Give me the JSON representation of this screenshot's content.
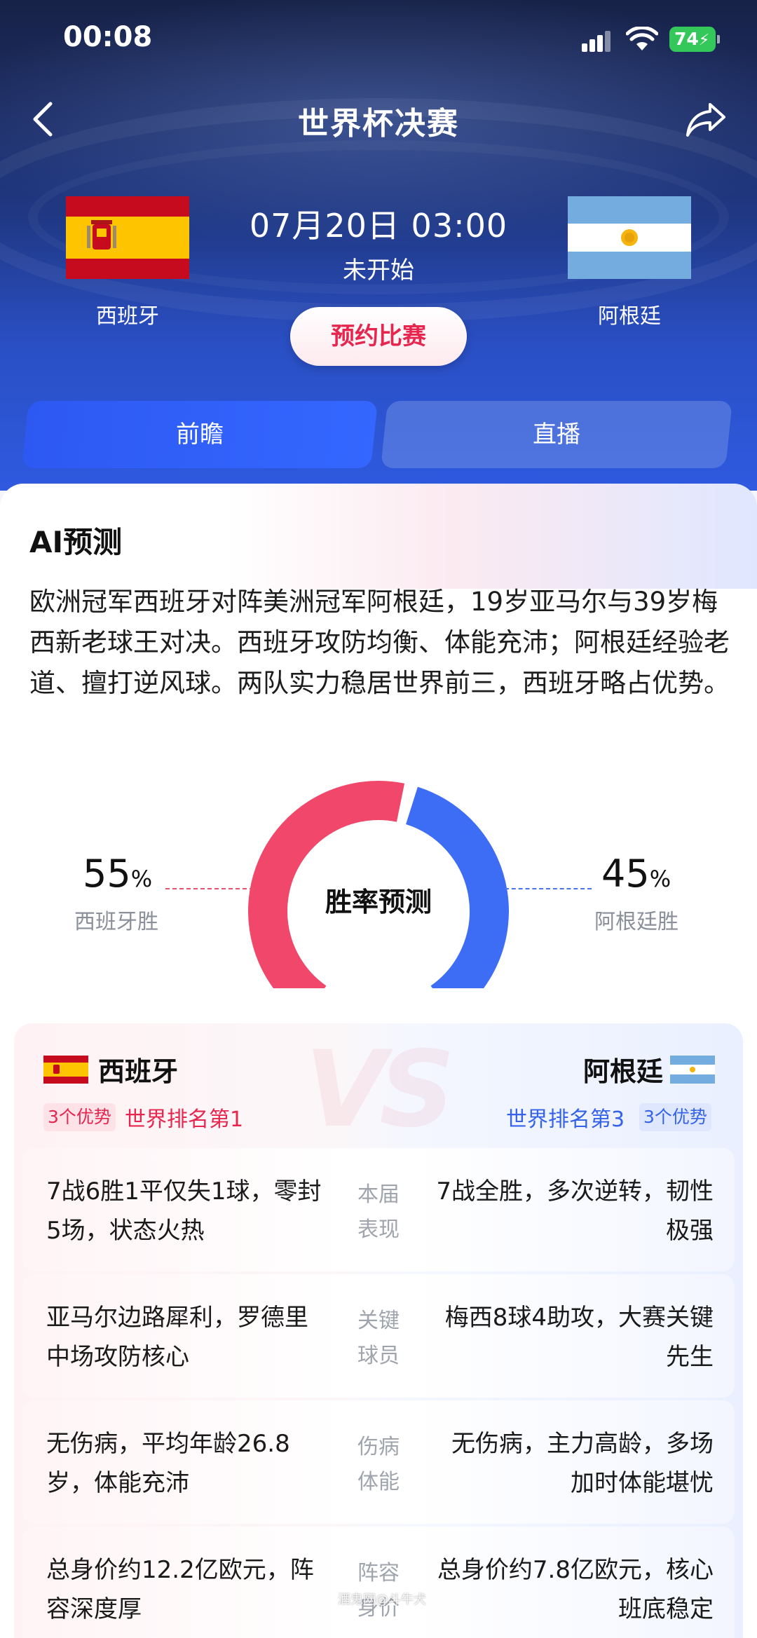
{
  "status_bar": {
    "time": "00:08",
    "battery": "74"
  },
  "nav": {
    "title": "世界杯决赛"
  },
  "match": {
    "datetime": "07月20日 03:00",
    "status": "未开始",
    "reserve_label": "预约比赛",
    "home_team": "西班牙",
    "away_team": "阿根廷"
  },
  "tabs": [
    {
      "label": "前瞻",
      "active": true
    },
    {
      "label": "直播",
      "active": false
    }
  ],
  "ai": {
    "title": "AI预测",
    "summary": "欧洲冠军西班牙对阵美洲冠军阿根廷，19岁亚马尔与39岁梅西新老球王对决。西班牙攻防均衡、体能充沛；阿根廷经验老道、擅打逆风球。两队实力稳居世界前三，西班牙略占优势。"
  },
  "prediction": {
    "center_label": "胜率预测",
    "home_pct": "55",
    "away_pct": "45",
    "pct_unit": "%",
    "home_label": "西班牙胜",
    "away_label": "阿根廷胜",
    "home_fraction": 0.55,
    "away_fraction": 0.45,
    "colors": {
      "home": "#f0476a",
      "away": "#3d6cf5"
    }
  },
  "comparison": {
    "vs_text": "VS",
    "home_name": "西班牙",
    "away_name": "阿根廷",
    "home_badge": "3个优势",
    "away_badge": "3个优势",
    "home_rank": "世界排名第1",
    "away_rank": "世界排名第3",
    "rows": [
      {
        "category": "本届表现",
        "home": "7战6胜1平仅失1球，零封5场，状态火热",
        "away": "7战全胜，多次逆转，韧性极强"
      },
      {
        "category": "关键球员",
        "home": "亚马尔边路犀利，罗德里中场攻防核心",
        "away": "梅西8球4助攻，大赛关键先生"
      },
      {
        "category": "伤病体能",
        "home": "无伤病，平均年龄26.8岁，体能充沛",
        "away": "无伤病，主力高龄，多场加时体能堪忧"
      },
      {
        "category": "阵容身价",
        "home": "总身价约12.2亿欧元，阵容深度厚",
        "away": "总身价约7.8亿欧元，核心班底稳定"
      }
    ]
  },
  "watermark": "酒鬼网@斗牛犬"
}
